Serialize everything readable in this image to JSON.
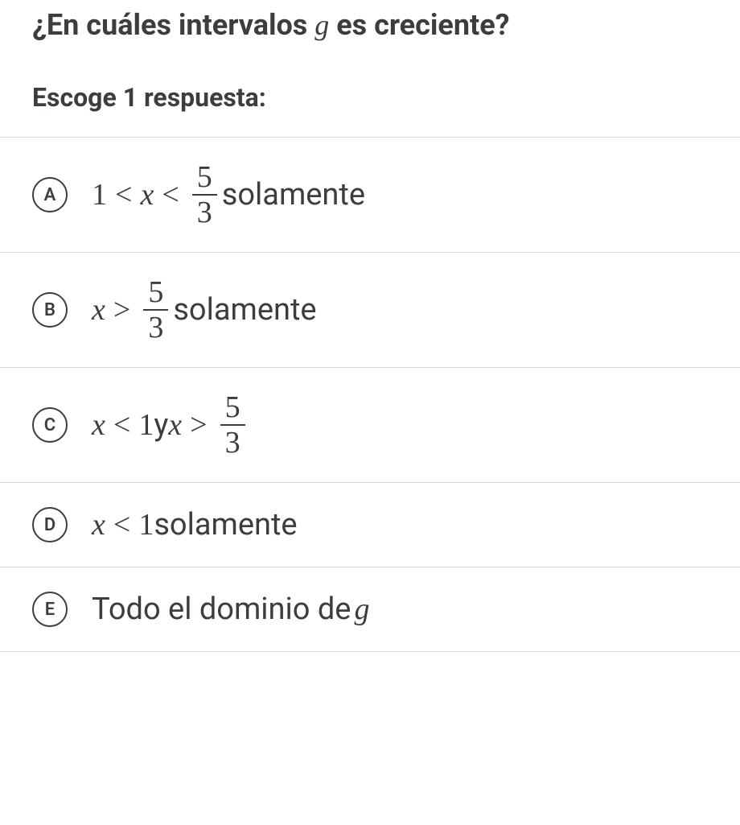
{
  "question": {
    "prefix": "¿En cuáles intervalos ",
    "var": "g",
    "suffix": " es creciente?"
  },
  "instruction": "Escoge 1 respuesta:",
  "options": {
    "a": {
      "letter": "A",
      "num1": "1",
      "lt1": "<",
      "var": "x",
      "lt2": "<",
      "frac_num": "5",
      "frac_den": "3",
      "suffix": " solamente"
    },
    "b": {
      "letter": "B",
      "var": "x",
      "gt": ">",
      "frac_num": "5",
      "frac_den": "3",
      "suffix": " solamente"
    },
    "c": {
      "letter": "C",
      "var1": "x",
      "lt": "<",
      "num1": "1",
      "conj": " y ",
      "var2": "x",
      "gt": ">",
      "frac_num": "5",
      "frac_den": "3"
    },
    "d": {
      "letter": "D",
      "var": "x",
      "lt": "<",
      "num": "1",
      "suffix": " solamente"
    },
    "e": {
      "letter": "E",
      "prefix": "Todo el dominio de ",
      "var": "g"
    }
  }
}
